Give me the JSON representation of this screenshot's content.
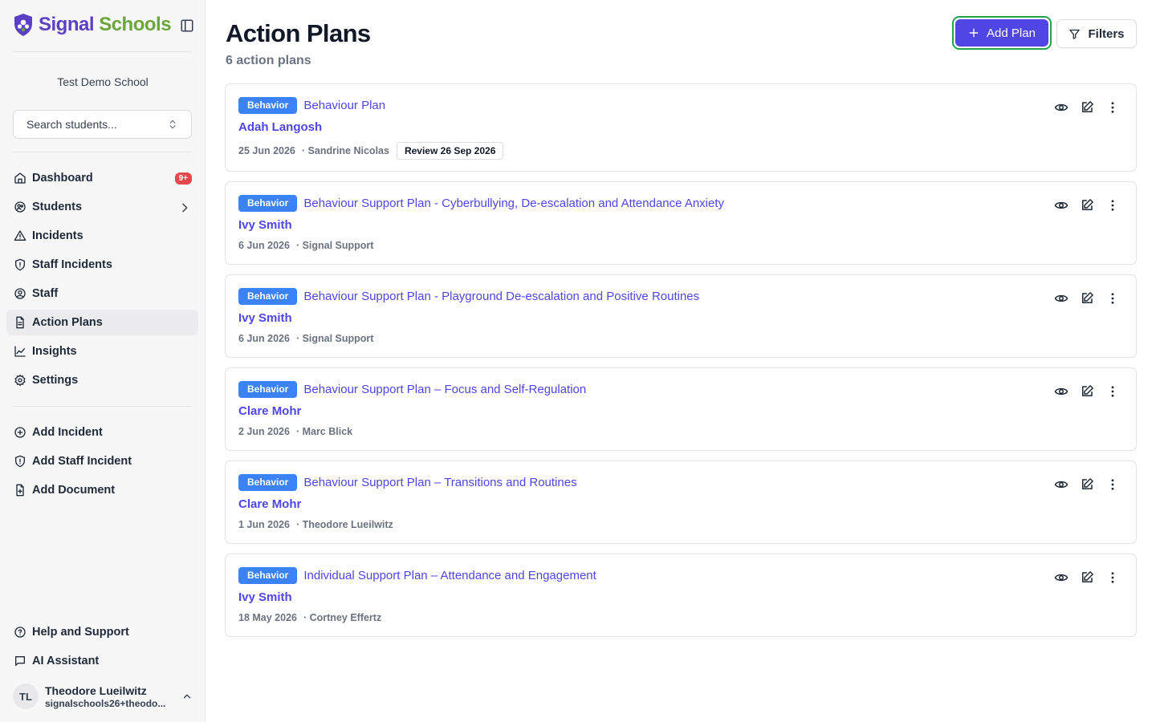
{
  "sidebar": {
    "brand": {
      "word1": "Signal",
      "word2": "Schools"
    },
    "school_name": "Test Demo School",
    "search_placeholder": "Search students...",
    "nav_items": [
      {
        "label": "Dashboard",
        "icon": "home-icon",
        "badge": "9+"
      },
      {
        "label": "Students",
        "icon": "users-icon",
        "has_chevron": true
      },
      {
        "label": "Incidents",
        "icon": "alert-triangle-icon"
      },
      {
        "label": "Staff Incidents",
        "icon": "shield-icon"
      },
      {
        "label": "Staff",
        "icon": "user-circle-icon"
      },
      {
        "label": "Action Plans",
        "icon": "file-text-icon",
        "active": true
      },
      {
        "label": "Insights",
        "icon": "line-chart-icon"
      },
      {
        "label": "Settings",
        "icon": "gear-icon"
      }
    ],
    "quick_actions": [
      {
        "label": "Add Incident",
        "icon": "plus-circle-icon"
      },
      {
        "label": "Add Staff Incident",
        "icon": "shield-plus-icon"
      },
      {
        "label": "Add Document",
        "icon": "file-plus-icon"
      }
    ],
    "footer_items": [
      {
        "label": "Help and Support",
        "icon": "help-circle-icon"
      },
      {
        "label": "AI Assistant",
        "icon": "message-square-icon"
      }
    ],
    "user": {
      "initials": "TL",
      "name": "Theodore Lueilwitz",
      "email": "signalschools26+theodo..."
    }
  },
  "header": {
    "title": "Action Plans",
    "subtitle": "6 action plans",
    "add_button_label": "Add Plan",
    "filters_button_label": "Filters"
  },
  "plans": [
    {
      "category": "Behavior",
      "title": "Behaviour Plan",
      "student": "Adah Langosh",
      "date": "25 Jun 2026",
      "author": "· Sandrine Nicolas",
      "review": "Review 26 Sep 2026"
    },
    {
      "category": "Behavior",
      "title": "Behaviour Support Plan - Cyberbullying, De-escalation and Attendance Anxiety",
      "student": "Ivy Smith",
      "date": "6 Jun 2026",
      "author": "· Signal Support",
      "review": ""
    },
    {
      "category": "Behavior",
      "title": "Behaviour Support Plan - Playground De-escalation and Positive Routines",
      "student": "Ivy Smith",
      "date": "6 Jun 2026",
      "author": "· Signal Support",
      "review": ""
    },
    {
      "category": "Behavior",
      "title": "Behaviour Support Plan – Focus and Self-Regulation",
      "student": "Clare Mohr",
      "date": "2 Jun 2026",
      "author": "· Marc Blick",
      "review": ""
    },
    {
      "category": "Behavior",
      "title": "Behaviour Support Plan – Transitions and Routines",
      "student": "Clare Mohr",
      "date": "1 Jun 2026",
      "author": "· Theodore Lueilwitz",
      "review": ""
    },
    {
      "category": "Behavior",
      "title": "Individual Support Plan – Attendance and Engagement",
      "student": "Ivy Smith",
      "date": "18 May 2026",
      "author": "· Cortney Effertz",
      "review": ""
    }
  ],
  "colors": {
    "accent": "#4f46e5",
    "badge_blue": "#3b82f6",
    "notification_red": "#e5484d",
    "focus_ring": "#22a34a",
    "brand_purple": "#5b3fc4",
    "brand_green": "#6aa63a"
  }
}
